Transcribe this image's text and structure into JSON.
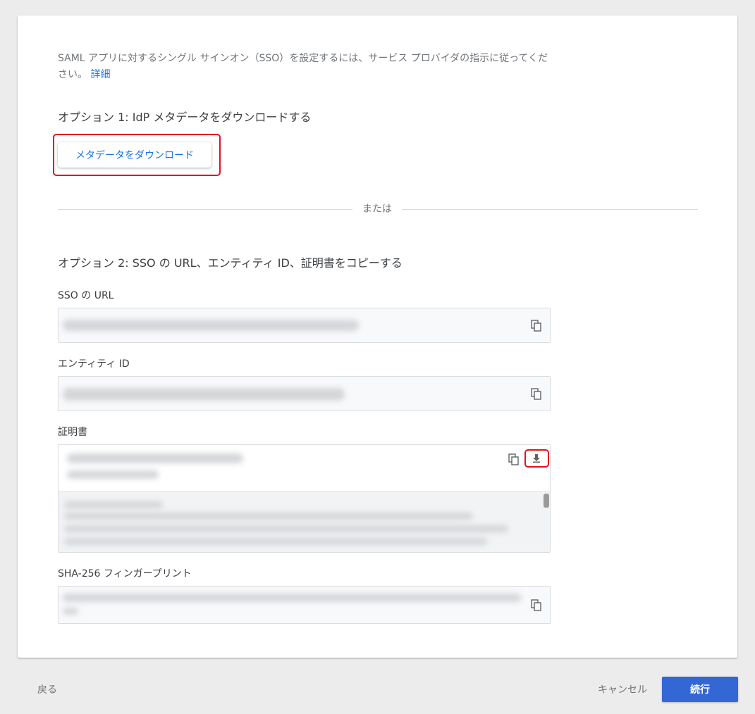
{
  "intro": {
    "text": "SAML アプリに対するシングル サインオン（SSO）を設定するには、サービス プロバイダの指示に従ってください。",
    "link": "詳細"
  },
  "option1": {
    "title": "オプション 1: IdP メタデータをダウンロードする",
    "button": "メタデータをダウンロード"
  },
  "divider_text": "または",
  "option2": {
    "title": "オプション 2: SSO の URL、エンティティ ID、証明書をコピーする"
  },
  "fields": {
    "sso_url_label": "SSO の URL",
    "entity_id_label": "エンティティ ID",
    "certificate_label": "証明書",
    "fingerprint_label": "SHA-256 フィンガープリント"
  },
  "footer": {
    "back": "戻る",
    "cancel": "キャンセル",
    "continue": "続行"
  },
  "colors": {
    "accent": "#3367d6",
    "link": "#1a73e8",
    "highlight": "#e3111d"
  },
  "icons": [
    "copy-icon",
    "download-icon"
  ]
}
